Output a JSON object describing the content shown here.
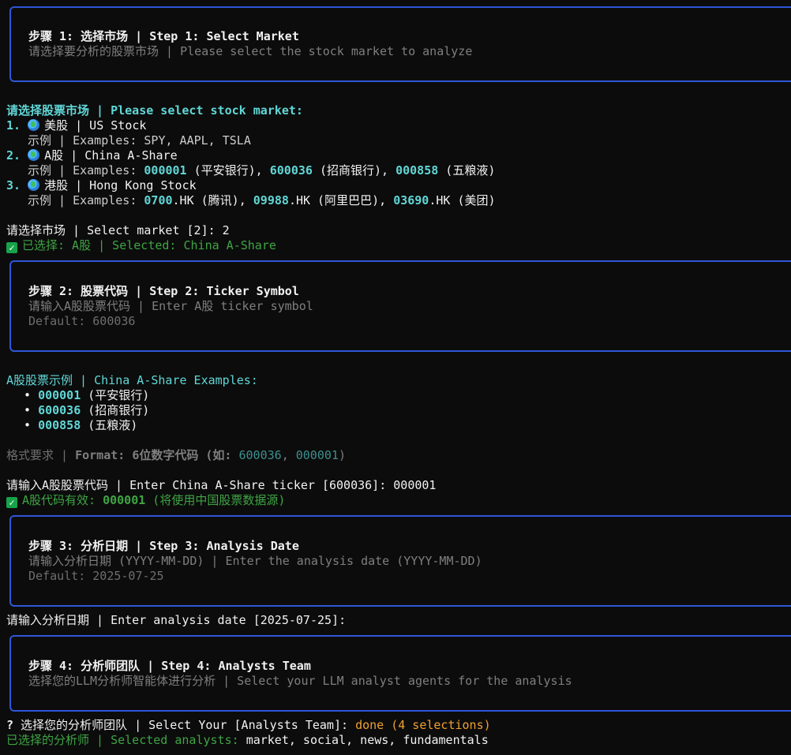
{
  "step1": {
    "title": "步骤 1: 选择市场 | Step 1: Select Market",
    "subtitle": "请选择要分析的股票市场 | Please select the stock market to analyze"
  },
  "market_prompt": "请选择股票市场 | Please select stock market:",
  "markets": [
    {
      "num": "1.",
      "label": "美股 | US Stock",
      "example_prefix": "示例 | Examples: ",
      "example_plain": "SPY, AAPL, TSLA"
    },
    {
      "num": "2.",
      "label": "A股 | China A-Share",
      "example_prefix": "示例 | Examples: ",
      "codes": [
        {
          "code": "000001",
          "name": " (平安银行), "
        },
        {
          "code": "600036",
          "name": " (招商银行), "
        },
        {
          "code": "000858",
          "name": " (五粮液)"
        }
      ]
    },
    {
      "num": "3.",
      "label": "港股 | Hong Kong Stock",
      "example_prefix": "示例 | Examples: ",
      "codes": [
        {
          "code": "0700",
          "suffix": ".HK",
          "name": " (腾讯), "
        },
        {
          "code": "09988",
          "suffix": ".HK",
          "name": " (阿里巴巴), "
        },
        {
          "code": "03690",
          "suffix": ".HK",
          "name": " (美团)"
        }
      ]
    }
  ],
  "market_select": "请选择市场 | Select market [2]: 2",
  "market_selected": "已选择: A股 | Selected: China A-Share",
  "step2": {
    "title": "步骤 2: 股票代码 | Step 2: Ticker Symbol",
    "subtitle": "请输入A股股票代码 | Enter A股 ticker symbol",
    "default": "Default: 600036"
  },
  "examples_title": "A股股票示例 | China A-Share Examples:",
  "examples": [
    {
      "code": "000001",
      "name": " (平安银行)"
    },
    {
      "code": "600036",
      "name": " (招商银行)"
    },
    {
      "code": "000858",
      "name": " (五粮液)"
    }
  ],
  "format": {
    "prefix": "格式要求 | ",
    "label": "Format: 6位数字代码 (如: ",
    "code1": "600036",
    "sep": ", ",
    "code2": "000001",
    "close": ")"
  },
  "ticker_input": "请输入A股股票代码 | Enter China A-Share ticker [600036]: 000001",
  "ticker_valid": {
    "prefix": "A股代码有效: ",
    "code": "000001",
    "suffix": " (将使用中国股票数据源)"
  },
  "step3": {
    "title": "步骤 3: 分析日期 | Step 3: Analysis Date",
    "subtitle": "请输入分析日期 (YYYY-MM-DD) | Enter the analysis date (YYYY-MM-DD)",
    "default": "Default: 2025-07-25"
  },
  "date_input": "请输入分析日期 | Enter analysis date [2025-07-25]:",
  "step4": {
    "title": "步骤 4: 分析师团队 | Step 4: Analysts Team",
    "subtitle": "选择您的LLM分析师智能体进行分析 | Select your LLM analyst agents for the analysis"
  },
  "team_prompt": {
    "mark": "?",
    "text": " 选择您的分析师团队 | Select Your [Analysts Team]: ",
    "answer": "done (4 selections)"
  },
  "selected_analysts": {
    "label": "已选择的分析师 | Selected analysts: ",
    "value": "market, social, news, fundamentals"
  },
  "colors": {
    "panel_border": "#2f56d8",
    "cyan": "#61d6d6",
    "green": "#3ea544",
    "orange": "#f0a030",
    "background": "#0c0c0c"
  }
}
